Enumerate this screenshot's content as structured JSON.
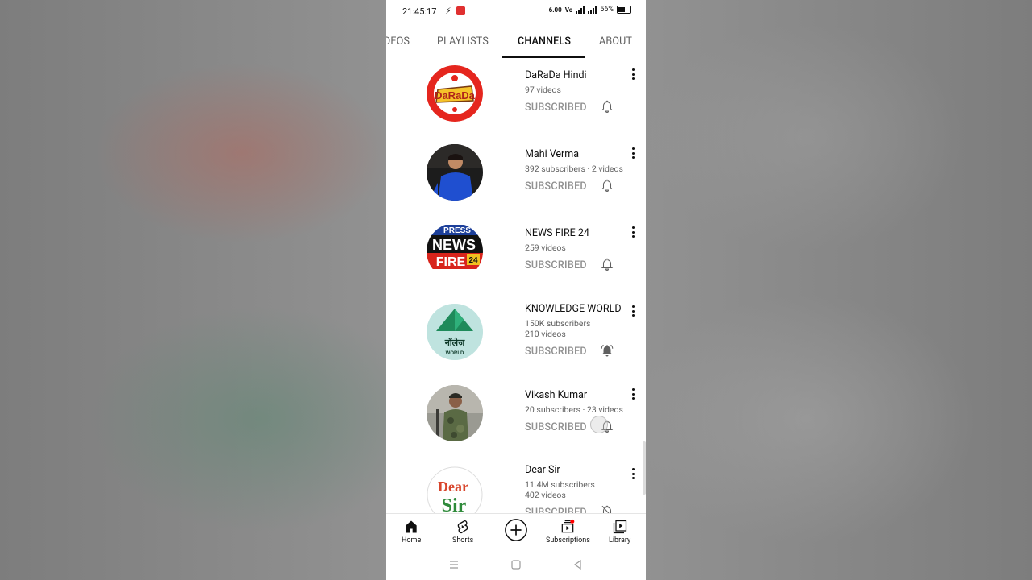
{
  "status_bar": {
    "time": "21:45:17",
    "net_speed": "6.00",
    "battery": "56%"
  },
  "tabs": [
    {
      "label": "DEOS"
    },
    {
      "label": "PLAYLISTS"
    },
    {
      "label": "CHANNELS"
    },
    {
      "label": "ABOUT"
    }
  ],
  "channels": [
    {
      "name": "DaRaDa Hindi",
      "meta1": "97 videos",
      "meta2": "",
      "status": "SUBSCRIBED",
      "avatar_text": "DaRaDa",
      "notifications": "off"
    },
    {
      "name": "Mahi Verma",
      "meta1": "392 subscribers · 2 videos",
      "meta2": "",
      "status": "SUBSCRIBED",
      "avatar_text": "",
      "notifications": "off"
    },
    {
      "name": "NEWS FIRE 24",
      "meta1": "259 videos",
      "meta2": "",
      "status": "SUBSCRIBED",
      "avatar_text": "NEWS",
      "avatar_text2": "FIRE",
      "avatar_text3": "24",
      "avatar_text4": "PRESS",
      "notifications": "off"
    },
    {
      "name": "KNOWLEDGE WORLD",
      "meta1": "150K subscribers",
      "meta2": "210 videos",
      "status": "SUBSCRIBED",
      "avatar_text": "नॉलेज",
      "avatar_text2": "WORLD",
      "notifications": "on"
    },
    {
      "name": "Vikash Kumar",
      "meta1": "20 subscribers · 23 videos",
      "meta2": "",
      "status": "SUBSCRIBED",
      "avatar_text": "",
      "notifications": "off"
    },
    {
      "name": "Dear Sir",
      "meta1": "11.4M subscribers",
      "meta2": "402 videos",
      "status": "SUBSCRIBED",
      "avatar_text": "Dear",
      "avatar_text2": "Sir",
      "notifications": "muted"
    }
  ],
  "bottom_nav": {
    "home": "Home",
    "shorts": "Shorts",
    "subscriptions": "Subscriptions",
    "library": "Library"
  },
  "colors": {
    "text_primary": "#0f0f0f",
    "text_secondary": "#606060",
    "subscribed": "#909090",
    "notification_dot": "#ff0000"
  }
}
